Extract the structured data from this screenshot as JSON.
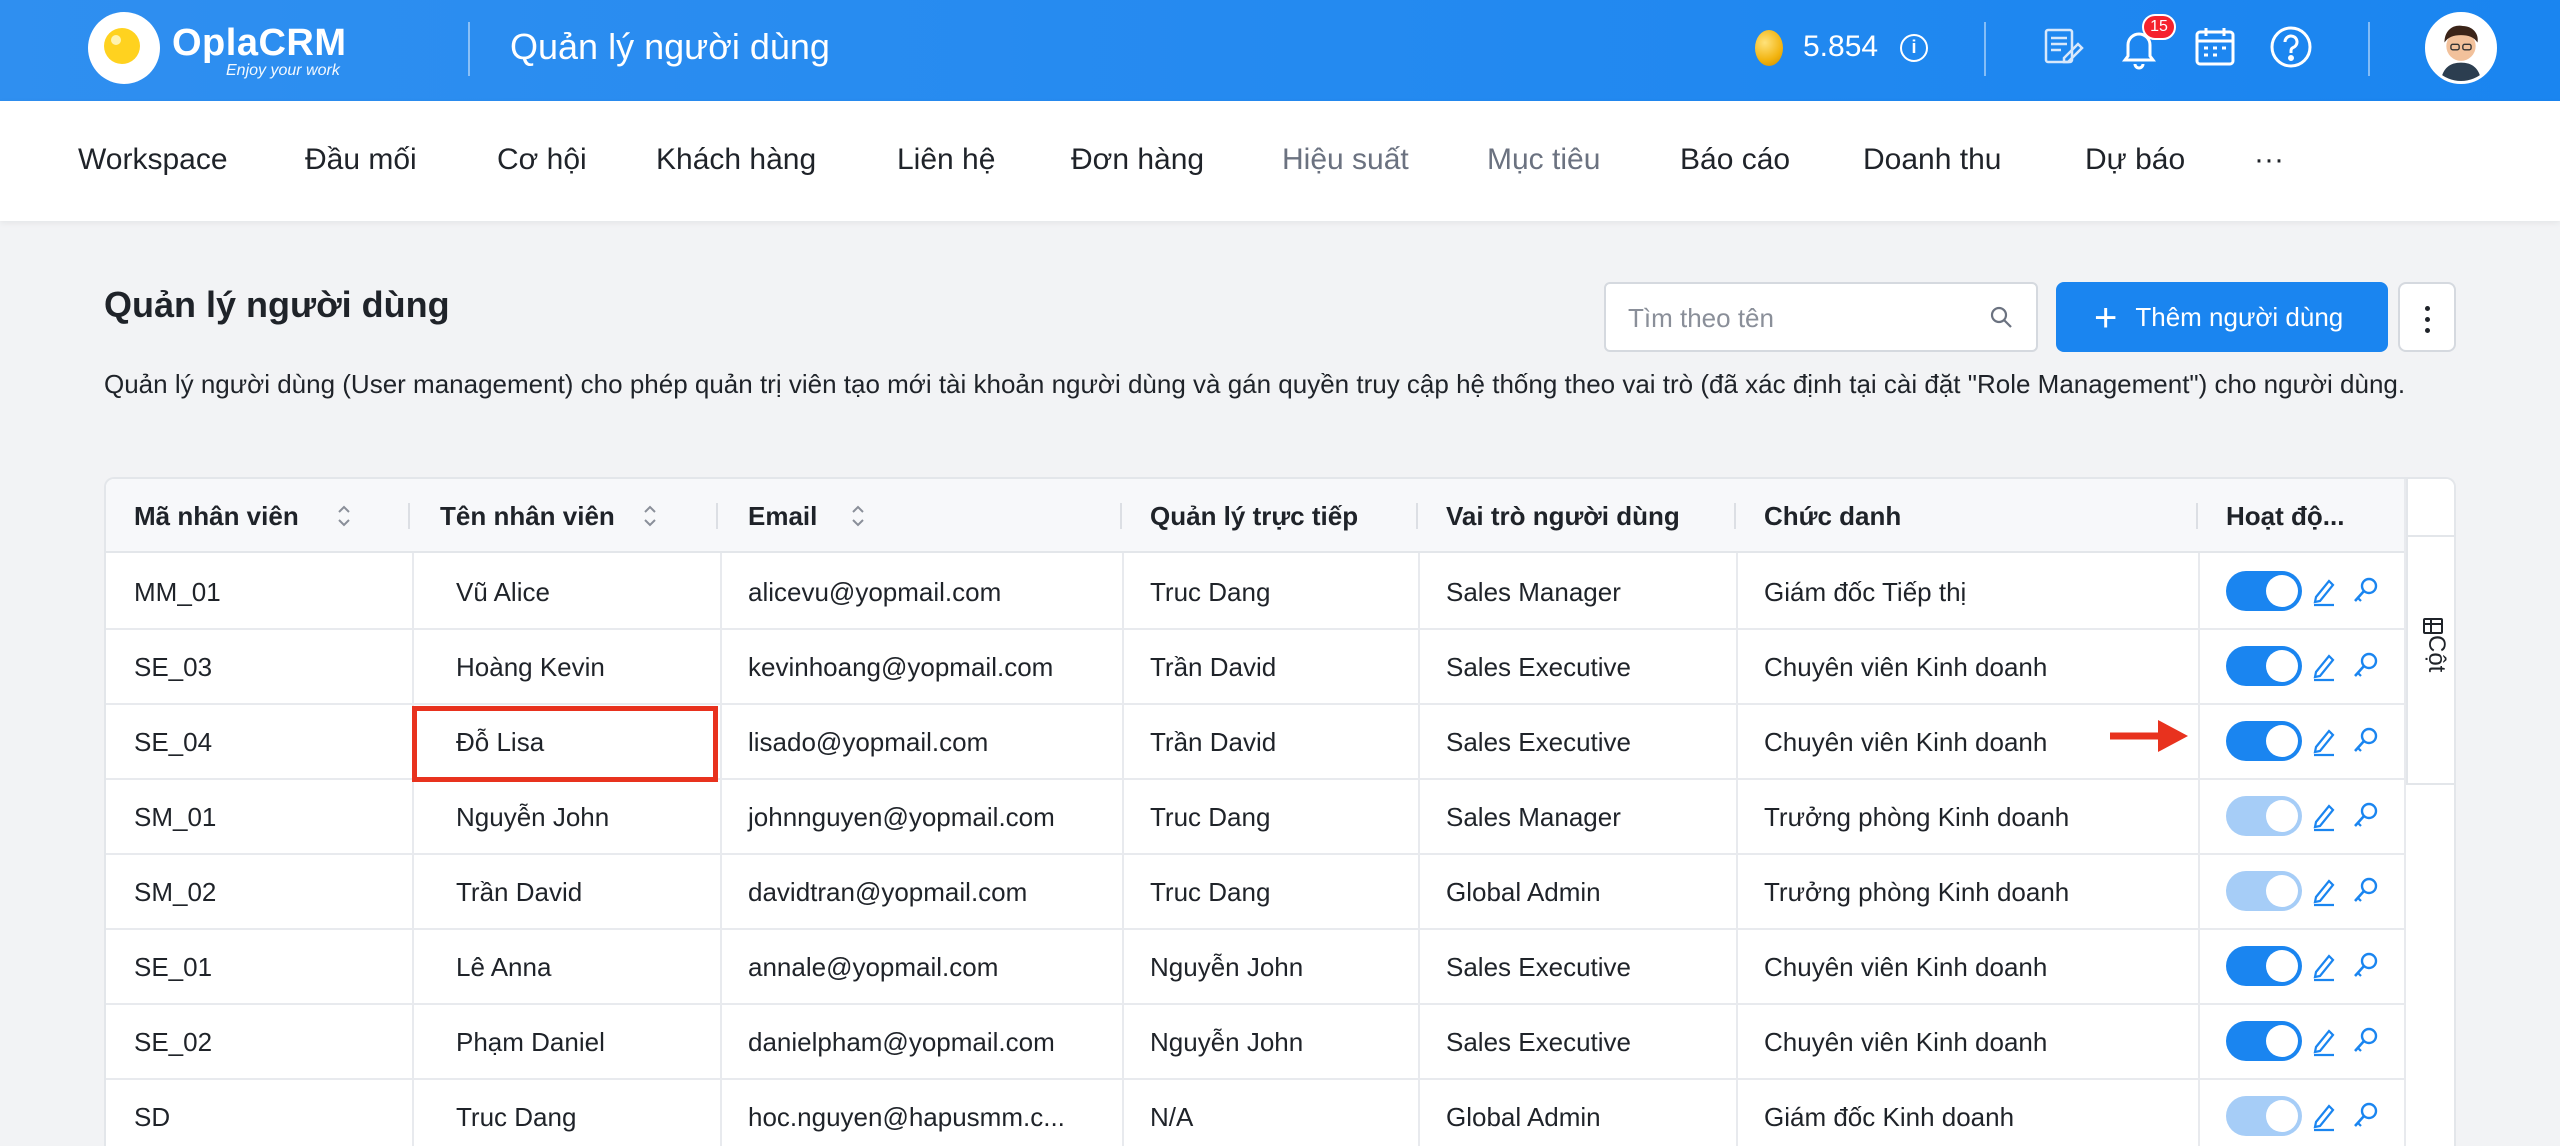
{
  "header": {
    "brand": "OplaCRM",
    "slogan": "Enjoy your work",
    "page_title": "Quản lý người dùng",
    "coins": "5.854",
    "notification_count": "15",
    "brand_color": "#1a85f0"
  },
  "nav": {
    "items": [
      {
        "label": "Workspace"
      },
      {
        "label": "Đầu mối"
      },
      {
        "label": "Cơ hội"
      },
      {
        "label": "Khách hàng"
      },
      {
        "label": "Liên hệ"
      },
      {
        "label": "Đơn hàng"
      },
      {
        "label": "Hiệu suất"
      },
      {
        "label": "Mục tiêu"
      },
      {
        "label": "Báo cáo"
      },
      {
        "label": "Doanh thu"
      },
      {
        "label": "Dự báo"
      },
      {
        "label": "···"
      }
    ]
  },
  "main": {
    "title": "Quản lý người dùng",
    "description": "Quản lý người dùng (User management) cho phép quản trị viên tạo mới tài khoản người dùng và gán quyền truy cập hệ thống theo vai trò (đã xác định tại cài đặt \"Role Management\") cho người dùng.",
    "search_placeholder": "Tìm theo tên",
    "add_button": "Thêm người dùng",
    "columns_panel_label": "Cột"
  },
  "table": {
    "columns": [
      "Mã nhân viên",
      "Tên nhân viên",
      "Email",
      "Quản lý trực tiếp",
      "Vai trò người dùng",
      "Chức danh",
      "Hoạt độ..."
    ],
    "rows": [
      {
        "code": "MM_01",
        "name": "Vũ Alice",
        "email": "alicevu@yopmail.com",
        "manager": "Truc Dang",
        "role": "Sales Manager",
        "title": "Giám đốc Tiếp thị",
        "active": true
      },
      {
        "code": "SE_03",
        "name": "Hoàng Kevin",
        "email": "kevinhoang@yopmail.com",
        "manager": "Trần David",
        "role": "Sales Executive",
        "title": "Chuyên viên Kinh doanh",
        "active": true
      },
      {
        "code": "SE_04",
        "name": "Đỗ Lisa",
        "email": "lisado@yopmail.com",
        "manager": "Trần David",
        "role": "Sales Executive",
        "title": "Chuyên viên Kinh doanh",
        "active": true
      },
      {
        "code": "SM_01",
        "name": "Nguyễn John",
        "email": "johnnguyen@yopmail.com",
        "manager": "Truc Dang",
        "role": "Sales Manager",
        "title": "Trưởng phòng Kinh doanh",
        "active": false
      },
      {
        "code": "SM_02",
        "name": "Trần David",
        "email": "davidtran@yopmail.com",
        "manager": "Truc Dang",
        "role": "Global Admin",
        "title": "Trưởng phòng Kinh doanh",
        "active": false
      },
      {
        "code": "SE_01",
        "name": "Lê Anna",
        "email": "annale@yopmail.com",
        "manager": "Nguyễn John",
        "role": "Sales Executive",
        "title": "Chuyên viên Kinh doanh",
        "active": true
      },
      {
        "code": "SE_02",
        "name": "Phạm Daniel",
        "email": "danielpham@yopmail.com",
        "manager": "Nguyễn John",
        "role": "Sales Executive",
        "title": "Chuyên viên Kinh doanh",
        "active": true
      },
      {
        "code": "SD",
        "name": "Truc Dang",
        "email": "hoc.nguyen@hapusmm.c...",
        "manager": "N/A",
        "role": "Global Admin",
        "title": "Giám đốc Kinh doanh",
        "active": false
      }
    ]
  },
  "annotation": {
    "highlight_color": "#e8321e"
  }
}
